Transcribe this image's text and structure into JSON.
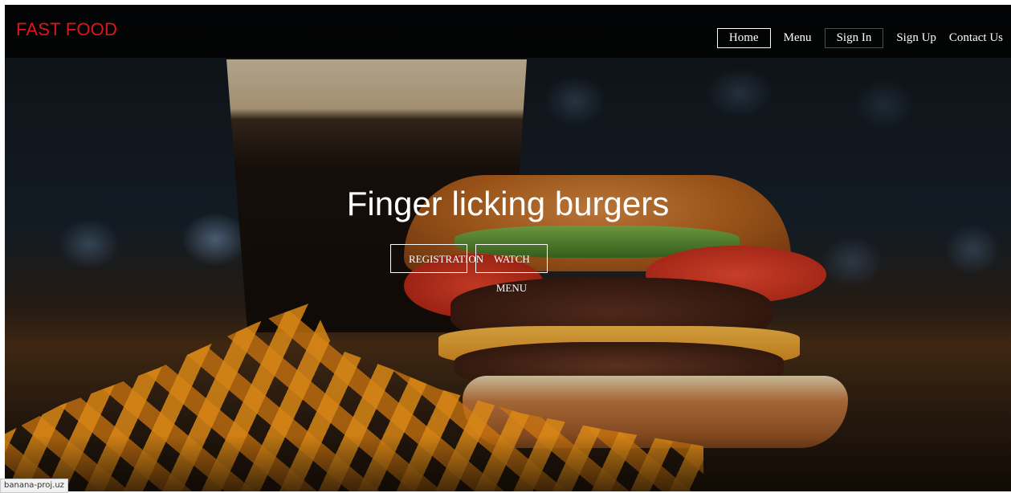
{
  "navbar": {
    "brand": "FAST FOOD",
    "brand_color": "#e0151b",
    "items": [
      {
        "label": "Home",
        "active": true
      },
      {
        "label": "Menu"
      },
      {
        "label": "Sign In",
        "accent": "#d8141a"
      },
      {
        "label": "Sign Up"
      },
      {
        "label": "Contact Us"
      }
    ]
  },
  "hero": {
    "title": "Finger licking burgers",
    "buttons": {
      "registration": "REGISTRATION",
      "watch_menu": "WATCH MENU"
    }
  },
  "status_bar": {
    "url": "banana-proj.uz"
  }
}
